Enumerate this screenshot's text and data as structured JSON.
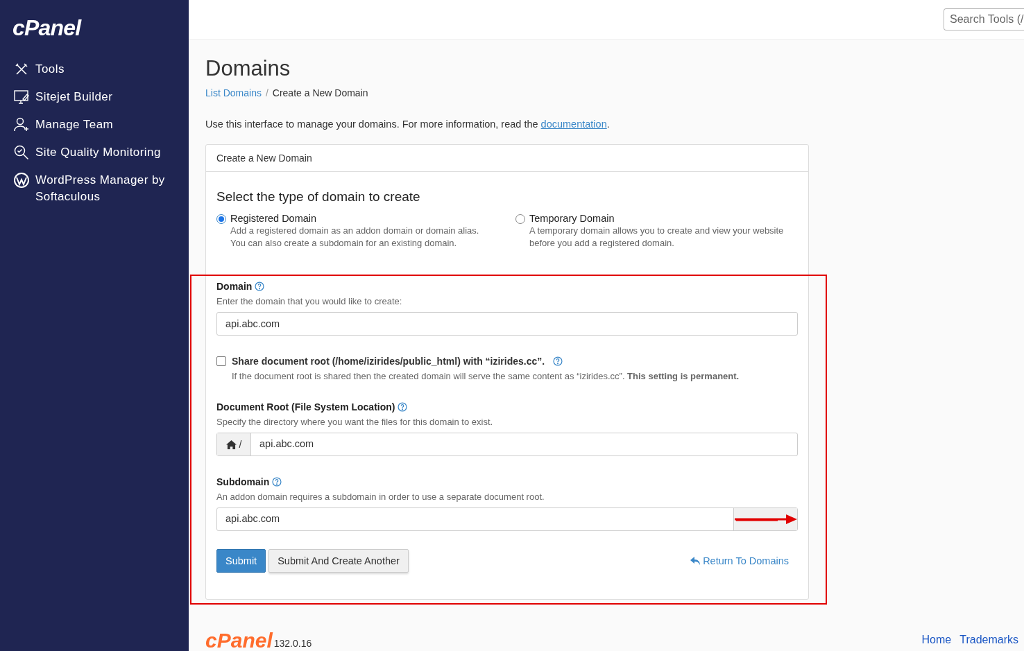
{
  "sidebar": {
    "logo": "cPanel",
    "items": [
      {
        "kind": "tools",
        "label": "Tools"
      },
      {
        "kind": "sitejet",
        "label": "Sitejet Builder"
      },
      {
        "kind": "team",
        "label": "Manage Team"
      },
      {
        "kind": "quality",
        "label": "Site Quality Monitoring"
      },
      {
        "kind": "wordpress",
        "label": "WordPress Manager by Softaculous"
      }
    ]
  },
  "header": {
    "search": {
      "placeholder": "Search Tools (/"
    }
  },
  "page": {
    "title": "Domains",
    "breadcrumb_separator": "/",
    "breadcrumb": [
      {
        "label": "List Domains",
        "link": true
      },
      {
        "label": "Create a New Domain",
        "link": false
      }
    ],
    "intro": {
      "text": "Use this interface to manage your domains. For more information, read the",
      "link": "documentation",
      "end": "."
    }
  },
  "card": {
    "header": "Create a New Domain",
    "heading": "Select the type of domain to create",
    "domain_types": [
      {
        "label": "Registered Domain",
        "description": "Add a registered domain as an addon domain or domain alias. You can also create a subdomain for an existing domain.",
        "selected": true
      },
      {
        "label": "Temporary Domain",
        "description": "A temporary domain allows you to create and view your website before you add a registered domain.",
        "selected": false
      }
    ],
    "domain": {
      "label": "Domain",
      "hint": "Enter the domain that you would like to create:",
      "value": "api.abc.com"
    },
    "share_root": {
      "label": "Share document root (/home/izirides/public_html) with “izirides.cc”.",
      "checked": false,
      "note": "If the document root is shared then the created domain will serve the same content as “izirides.cc”. **This setting is permanent.**"
    },
    "document_root": {
      "label": "Document Root (File System Location)",
      "hint": "Specify the directory where you want the files for this domain to exist.",
      "prefix": "/",
      "value": "api.abc.com"
    },
    "subdomain": {
      "label": "Subdomain",
      "hint": "An addon domain requires a subdomain in order to use a separate document root.",
      "value": "api.abc.com"
    },
    "buttons": [
      {
        "kind": "primary",
        "label": "Submit"
      },
      {
        "kind": "default",
        "label": "Submit And Create Another"
      }
    ],
    "return_link": "Return To Domains"
  },
  "footer": {
    "logo": "cPanel",
    "version": "132.0.16",
    "links": [
      "Home",
      "Trademarks"
    ]
  }
}
